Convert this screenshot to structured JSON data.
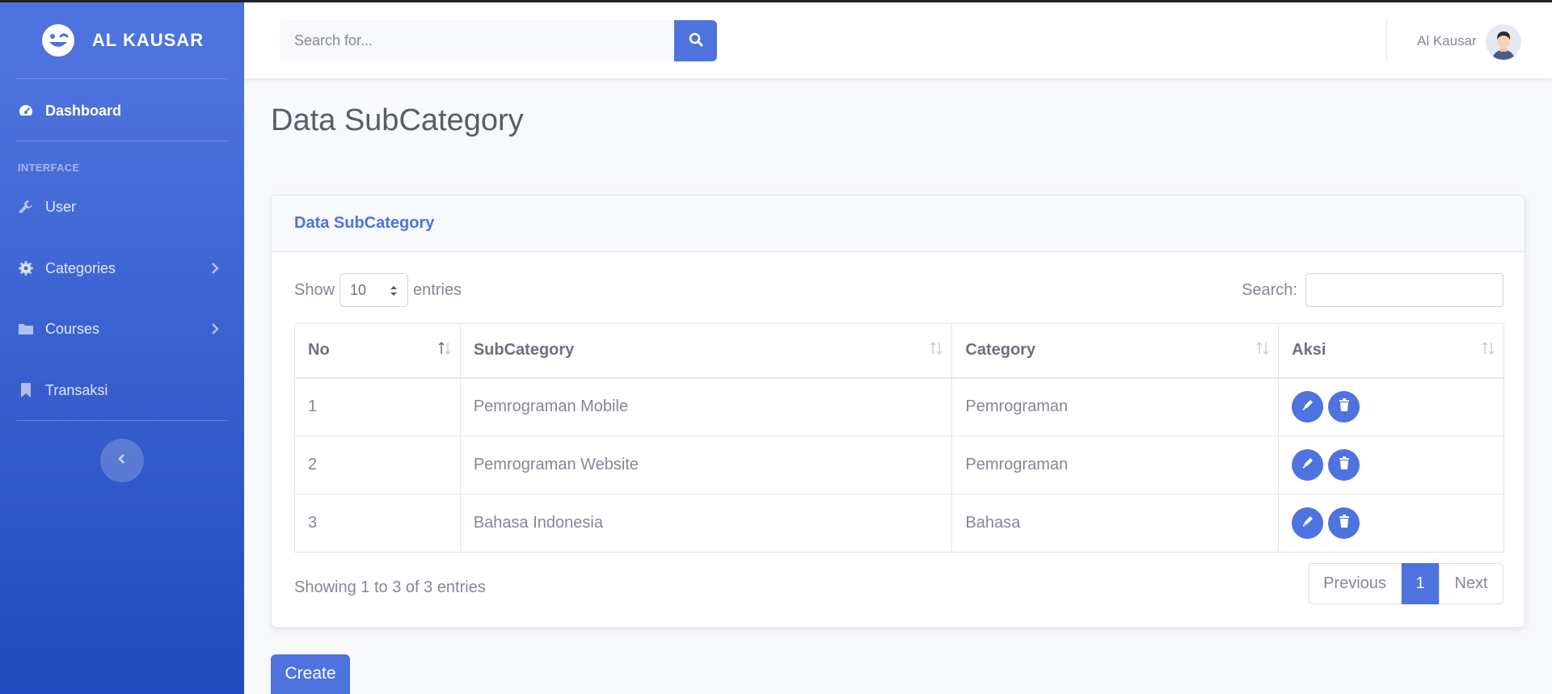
{
  "brand": {
    "name": "AL KAUSAR",
    "icon": "laugh-wink-icon"
  },
  "sidebar": {
    "dashboard": {
      "label": "Dashboard",
      "icon": "tachometer-icon"
    },
    "heading": "Interface",
    "items": [
      {
        "label": "User",
        "icon": "wrench-icon",
        "has_submenu": false
      },
      {
        "label": "Categories",
        "icon": "cog-icon",
        "has_submenu": true
      },
      {
        "label": "Courses",
        "icon": "folder-icon",
        "has_submenu": true
      },
      {
        "label": "Transaksi",
        "icon": "bookmark-icon",
        "has_submenu": false
      }
    ],
    "toggle_icon": "chevron-left-icon"
  },
  "topbar": {
    "search_placeholder": "Search for...",
    "search_icon": "search-icon",
    "user_name": "Al Kausar",
    "avatar_icon": "user-avatar"
  },
  "page": {
    "title": "Data SubCategory"
  },
  "card": {
    "title": "Data SubCategory",
    "length_prefix": "Show",
    "length_value": "10",
    "length_suffix": "entries",
    "search_label": "Search:",
    "search_value": "",
    "columns": [
      "No",
      "SubCategory",
      "Category",
      "Aksi"
    ],
    "rows": [
      {
        "no": "1",
        "subcategory": "Pemrograman Mobile",
        "category": "Pemrograman"
      },
      {
        "no": "2",
        "subcategory": "Pemrograman Website",
        "category": "Pemrograman"
      },
      {
        "no": "3",
        "subcategory": "Bahasa Indonesia",
        "category": "Bahasa"
      }
    ],
    "row_actions": [
      "edit-icon",
      "trash-icon"
    ],
    "info": "Showing 1 to 3 of 3 entries",
    "pagination": {
      "previous": "Previous",
      "current": "1",
      "next": "Next"
    }
  },
  "create_button": "Create",
  "colors": {
    "primary": "#4e73df",
    "sidebar_bottom": "#224abe",
    "text": "#858796",
    "background": "#f8f9fc"
  }
}
